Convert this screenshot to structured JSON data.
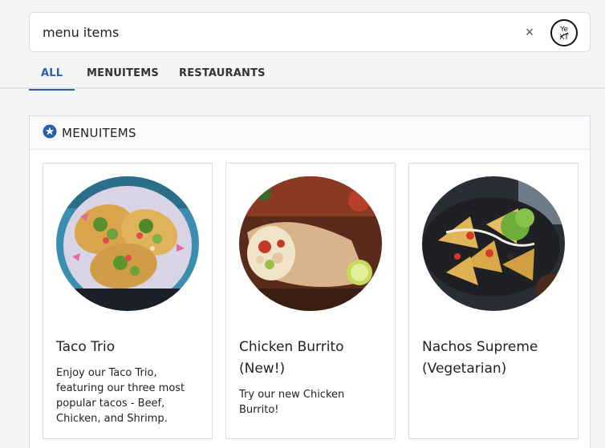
{
  "search": {
    "value": "menu items",
    "clear_icon": "close-icon",
    "logo_text_top": "Ye",
    "logo_text_bottom": "XT"
  },
  "tabs": [
    {
      "label": "ALL",
      "active": true
    },
    {
      "label": "MENUITEMS",
      "active": false
    },
    {
      "label": "RESTAURANTS",
      "active": false
    }
  ],
  "section": {
    "icon": "star-icon",
    "title": "MENUITEMS",
    "accent_color": "#2b5fad"
  },
  "cards": [
    {
      "title": "Taco Trio",
      "description": "Enjoy our Taco Trio, featuring our three most popular tacos - Beef, Chicken, and Shrimp."
    },
    {
      "title": "Chicken Burrito (New!)",
      "description": "Try our new Chicken Burrito!"
    },
    {
      "title": "Nachos Supreme (Vegetarian)",
      "description": ""
    }
  ]
}
